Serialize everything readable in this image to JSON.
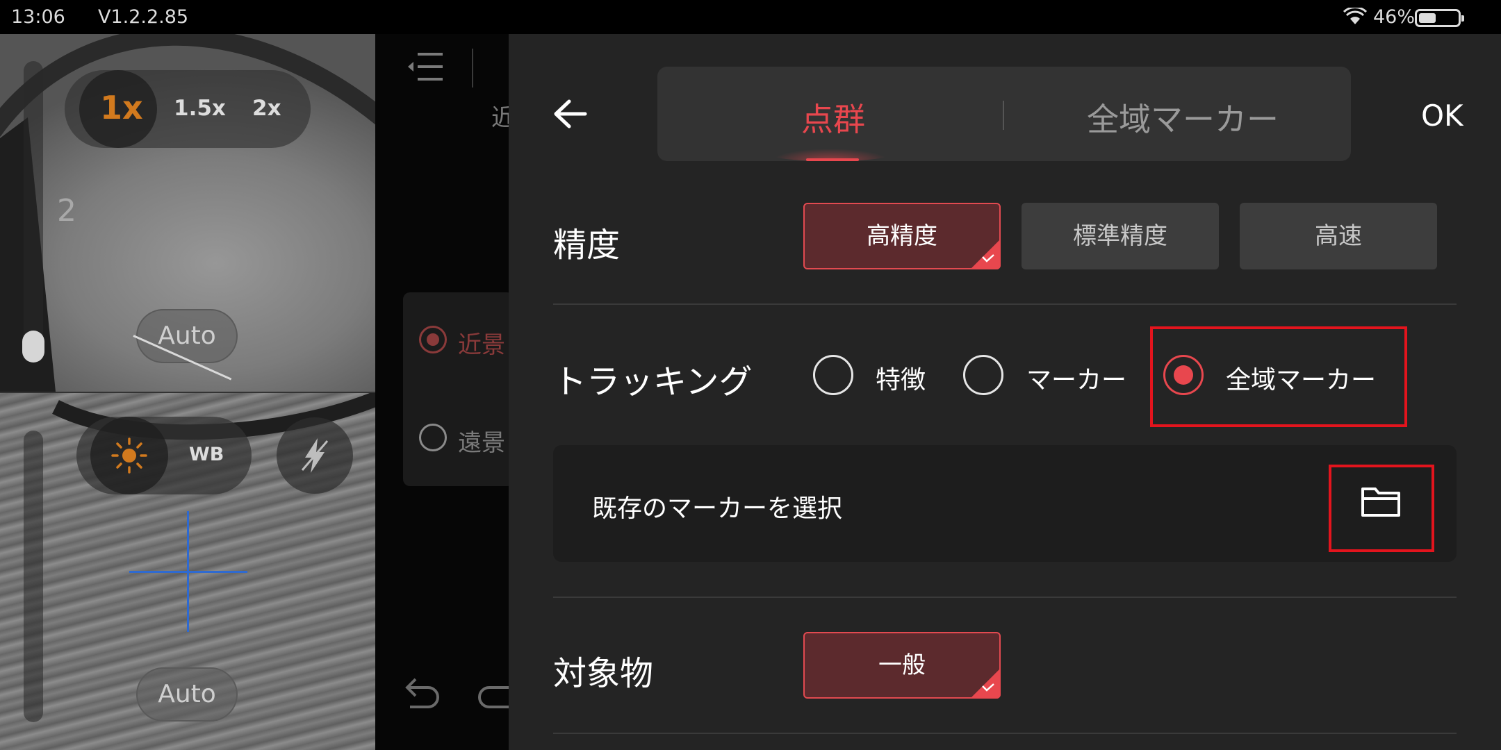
{
  "status_bar": {
    "time": "13:06",
    "version": "V1.2.2.85",
    "battery_percent": "46%",
    "battery_level": 0.46,
    "icons": [
      "wifi-icon",
      "battery-icon"
    ]
  },
  "camera": {
    "zoom_options": [
      "1x",
      "1.5x",
      "2x"
    ],
    "zoom_selected": "1x",
    "camera_label": "2",
    "exposure_auto_label": "Auto",
    "wb_label": "WB",
    "focus_auto_label": "Auto",
    "icons": [
      "sun-icon",
      "flash-auto-icon",
      "crosshair-icon"
    ]
  },
  "middle_panel": {
    "label_near": "近",
    "radio_near": "近景",
    "radio_far": "遠景",
    "icons": [
      "menu-collapse-icon",
      "undo-icon",
      "redo-icon"
    ]
  },
  "settings": {
    "tabs": [
      "点群",
      "全域マーカー"
    ],
    "active_tab": "点群",
    "ok_label": "OK",
    "accuracy": {
      "label": "精度",
      "options": [
        "高精度",
        "標準精度",
        "高速"
      ],
      "selected": "高精度"
    },
    "tracking": {
      "label": "トラッキング",
      "options": [
        "特徴",
        "マーカー",
        "全域マーカー"
      ],
      "selected": "全域マーカー"
    },
    "existing_marker": {
      "label": "既存のマーカーを選択"
    },
    "target": {
      "label": "対象物",
      "options": [
        "一般"
      ],
      "selected": "一般"
    }
  },
  "colors": {
    "accent": "#e8474e",
    "highlight_box": "#e3141d",
    "panel_bg": "#242424",
    "selected_option_bg": "#5c2a2d",
    "option_bg": "#3d3d3d",
    "zoom_selected": "#d27a1e",
    "crosshair": "#2f6ad0"
  }
}
